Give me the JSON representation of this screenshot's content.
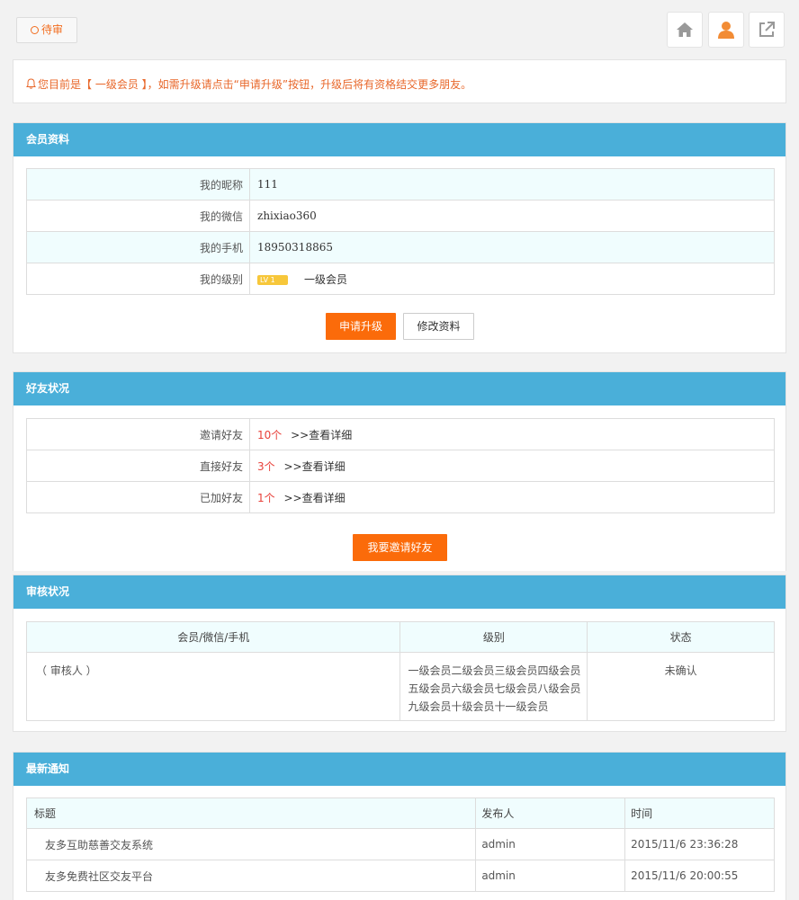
{
  "topbar": {
    "status_label": "待审",
    "icons": [
      "home-icon",
      "user-icon",
      "external-link-icon"
    ]
  },
  "notice": {
    "text": "您目前是【 一级会员 】，如需升级请点击“申请升级”按钮，升级后将有资格结交更多朋友。"
  },
  "profile": {
    "title": "会员资料",
    "rows": [
      {
        "label": "我的昵称",
        "value": "111"
      },
      {
        "label": "我的微信",
        "value": "zhixiao360"
      },
      {
        "label": "我的手机",
        "value": "18950318865"
      },
      {
        "label": "我的级别",
        "badge": "LV 1",
        "value": "一级会员"
      }
    ],
    "upgrade_button": "申请升级",
    "edit_button": "修改资料"
  },
  "friends": {
    "title": "好友状况",
    "rows": [
      {
        "label": "邀请好友",
        "count": "10个",
        "link": ">>查看详细"
      },
      {
        "label": "直接好友",
        "count": "3个",
        "link": ">>查看详细"
      },
      {
        "label": "已加好友",
        "count": "1个",
        "link": ">>查看详细"
      }
    ],
    "invite_button": "我要邀请好友"
  },
  "review": {
    "title": "审核状况",
    "columns": [
      "会员/微信/手机",
      "级别",
      "状态"
    ],
    "row": {
      "member": "（ 审核人 ）",
      "levels": "一级会员二级会员三级会员四级会员五级会员六级会员七级会员八级会员九级会员十级会员十一级会员",
      "status": "未确认"
    }
  },
  "news": {
    "title": "最新通知",
    "columns": [
      "标题",
      "发布人",
      "时间"
    ],
    "rows": [
      {
        "title": "友多互助慈善交友系统",
        "author": "admin",
        "time": "2015/11/6 23:36:28"
      },
      {
        "title": "友多免费社区交友平台",
        "author": "admin",
        "time": "2015/11/6 20:00:55"
      }
    ]
  },
  "colors": {
    "header_blue": "#4aafd9",
    "accent_orange": "#fb6b0a",
    "count_red": "#e8413a"
  }
}
